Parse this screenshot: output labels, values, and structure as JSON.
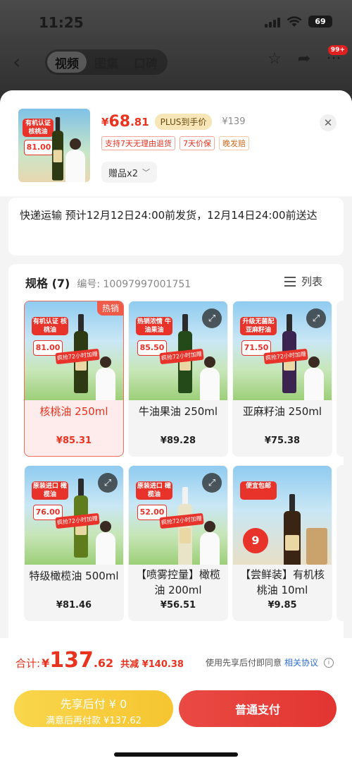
{
  "status_bar": {
    "time": "11:25",
    "battery": "69"
  },
  "top_nav": {
    "tabs": [
      {
        "label": "视频",
        "active": true
      },
      {
        "label": "图集",
        "active": false
      },
      {
        "label": "口碑",
        "active": false
      }
    ],
    "badge": "99+"
  },
  "product": {
    "price_symbol": "¥",
    "price_int": "68",
    "price_dec": ".81",
    "plus_label": "PLUS到手价",
    "original_price": "¥139",
    "tags": [
      "支持7天无理由退货",
      "7天价保",
      "晚发赔"
    ],
    "gift_label": "赠品x2"
  },
  "shipping": {
    "text": "快递运输 预计12月12日24:00前发货，12月14日24:00前送达"
  },
  "spec": {
    "title": "规格 (7)",
    "code": "编号: 10097997001751",
    "list_label": "列表",
    "hot_label": "热销",
    "items": [
      {
        "name": "核桃油 250ml",
        "price": "¥85.31",
        "banner": "有机认证 核桃油",
        "img_price": "81.00",
        "selected": true,
        "hot": true
      },
      {
        "name": "牛油果油 250ml",
        "price": "¥89.28",
        "banner": "热销浓情 牛油果油",
        "img_price": "85.50",
        "selected": false,
        "hot": false
      },
      {
        "name": "亚麻籽油 250ml",
        "price": "¥75.38",
        "banner": "升级无菌配 亚麻籽油",
        "img_price": "71.50",
        "selected": false,
        "hot": false
      },
      {
        "name": "特级橄榄油 500ml",
        "price": "¥81.46",
        "banner": "原装进口 橄榄油",
        "img_price": "76.00",
        "selected": false,
        "hot": false
      },
      {
        "name": "【喷雾控量】橄榄油 200ml",
        "price": "¥56.51",
        "banner": "原装进口 橄榄油",
        "img_price": "52.00",
        "selected": false,
        "hot": false
      },
      {
        "name": "【尝鲜装】有机核桃油 10ml",
        "price": "¥9.85",
        "banner": "便宜包邮",
        "img_price": "9",
        "selected": false,
        "hot": false
      }
    ],
    "img_promo": "疯抢72小时加赠"
  },
  "footer": {
    "total_label": "合计:",
    "total_yen": "¥",
    "total_int": "137",
    "total_dec": ".62",
    "saved": "共减 ¥140.38",
    "agree_text": "使用先享后付即同意",
    "agree_link": "相关协议",
    "later_line1": "先享后付 ¥ 0",
    "later_line2": "满意后再付款 ¥137.62",
    "pay_label": "普通支付"
  },
  "colors": {
    "accent_red": "#e8331f",
    "pay_button": "#e23531",
    "later_button": "#f6c531",
    "link_blue": "#2f6fd6"
  }
}
